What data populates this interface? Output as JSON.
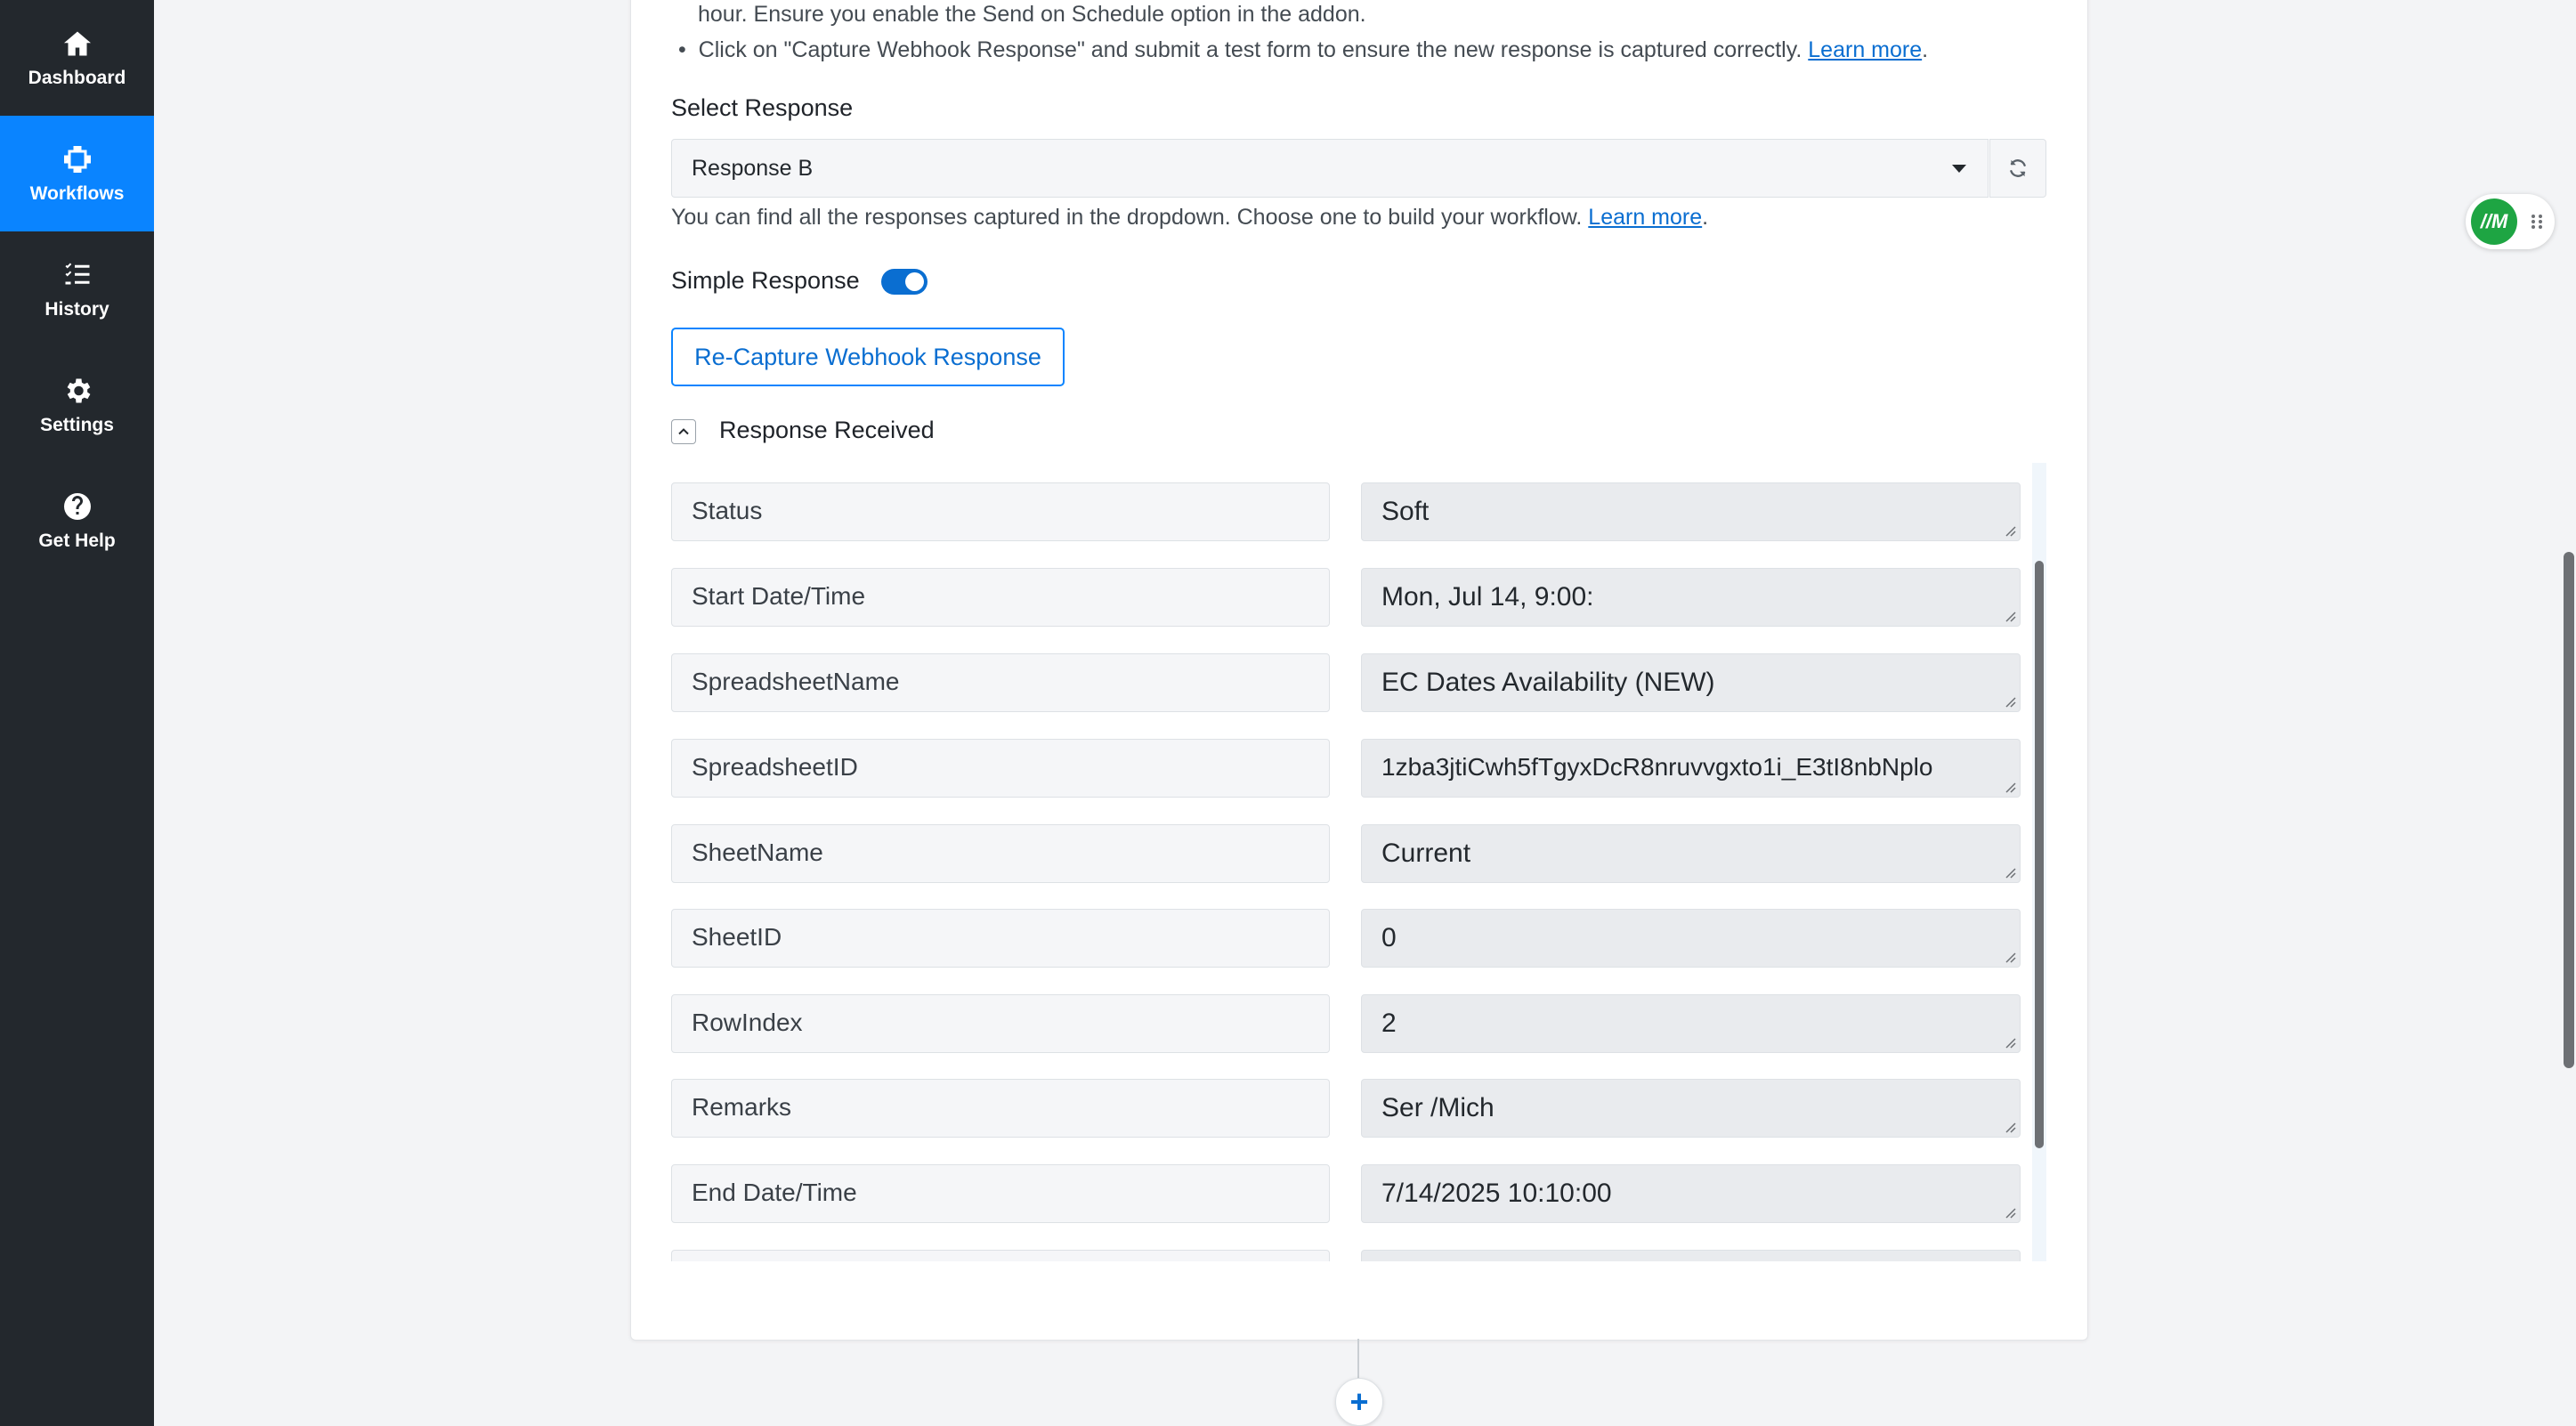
{
  "sidebar": {
    "items": [
      {
        "label": "Dashboard",
        "icon": "home-icon",
        "active": false
      },
      {
        "label": "Workflows",
        "icon": "workflow-icon",
        "active": true
      },
      {
        "label": "History",
        "icon": "history-list-icon",
        "active": false
      },
      {
        "label": "Settings",
        "icon": "gear-icon",
        "active": false
      },
      {
        "label": "Get Help",
        "icon": "help-circle-icon",
        "active": false
      }
    ]
  },
  "instructions": {
    "line1": "hour. Ensure you enable the Send on Schedule option in the addon.",
    "line2": "Click on \"Capture Webhook Response\" and submit a test form to ensure the new response is captured correctly.",
    "line2_link": "Learn more",
    "line2_end": "."
  },
  "select_response": {
    "label": "Select Response",
    "value": "Response B",
    "hint": "You can find all the responses captured in the dropdown. Choose one to build your workflow.",
    "hint_link": "Learn more",
    "hint_end": "."
  },
  "simple_response": {
    "label": "Simple Response",
    "enabled": true
  },
  "recapture_button": "Re-Capture Webhook Response",
  "response_received": {
    "title": "Response Received",
    "rows": [
      {
        "key": "Status",
        "value": "Soft"
      },
      {
        "key": "Start Date/Time",
        "value": "Mon, Jul 14, 9:00:"
      },
      {
        "key": "SpreadsheetName",
        "value": "EC Dates Availability (NEW)"
      },
      {
        "key": "SpreadsheetID",
        "value": "1zba3jtiCwh5fTgyxDcR8nruvvgxto1i_E3tI8nbNplo"
      },
      {
        "key": "SheetName",
        "value": "Current"
      },
      {
        "key": "SheetID",
        "value": "0"
      },
      {
        "key": "RowIndex",
        "value": "2"
      },
      {
        "key": "Remarks",
        "value": "Ser /Mich"
      },
      {
        "key": "End Date/Time",
        "value": "7/14/2025 10:10:00"
      },
      {
        "key": "",
        "value": ""
      }
    ]
  },
  "add_step": "+",
  "float_widget": {
    "logo_text": "//M"
  }
}
